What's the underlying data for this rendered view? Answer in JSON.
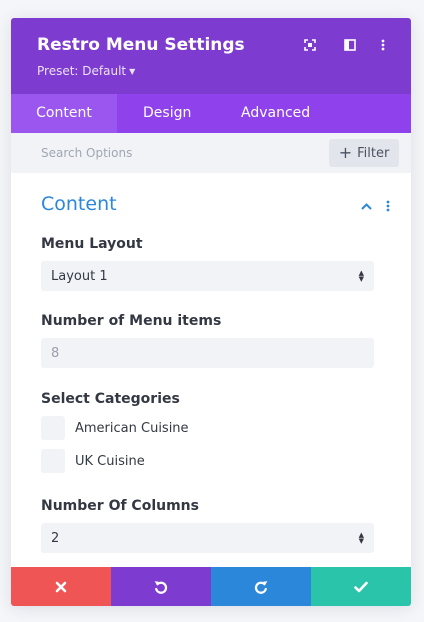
{
  "header": {
    "title": "Restro Menu Settings",
    "preset_label": "Preset: Default",
    "icons": [
      "fullscreen-icon",
      "sidebar-toggle-icon",
      "more-vertical-icon"
    ]
  },
  "tabs": [
    {
      "label": "Content",
      "active": true
    },
    {
      "label": "Design",
      "active": false
    },
    {
      "label": "Advanced",
      "active": false
    }
  ],
  "search": {
    "placeholder": "Search Options",
    "value": "",
    "filter_label": "Filter"
  },
  "section": {
    "title": "Content",
    "expanded": true
  },
  "fields": {
    "menu_layout": {
      "label": "Menu Layout",
      "value": "Layout 1"
    },
    "menu_items": {
      "label": "Number of Menu items",
      "placeholder": "8",
      "value": ""
    },
    "categories": {
      "label": "Select Categories",
      "options": [
        {
          "label": "American Cuisine",
          "checked": false
        },
        {
          "label": "UK Cuisine",
          "checked": false
        }
      ]
    },
    "columns": {
      "label": "Number Of Columns",
      "value": "2"
    }
  },
  "footer": {
    "buttons": [
      {
        "name": "discard",
        "icon": "close-icon",
        "color": "#ef5555"
      },
      {
        "name": "undo",
        "icon": "undo-icon",
        "color": "#7e3bd0"
      },
      {
        "name": "redo",
        "icon": "redo-icon",
        "color": "#2b87da"
      },
      {
        "name": "save",
        "icon": "check-icon",
        "color": "#29c4a9"
      }
    ]
  },
  "colors": {
    "header": "#7e3bd0",
    "tabs": "#8f42ec",
    "active_tab": "#9b56ef",
    "accent": "#2b87da"
  }
}
